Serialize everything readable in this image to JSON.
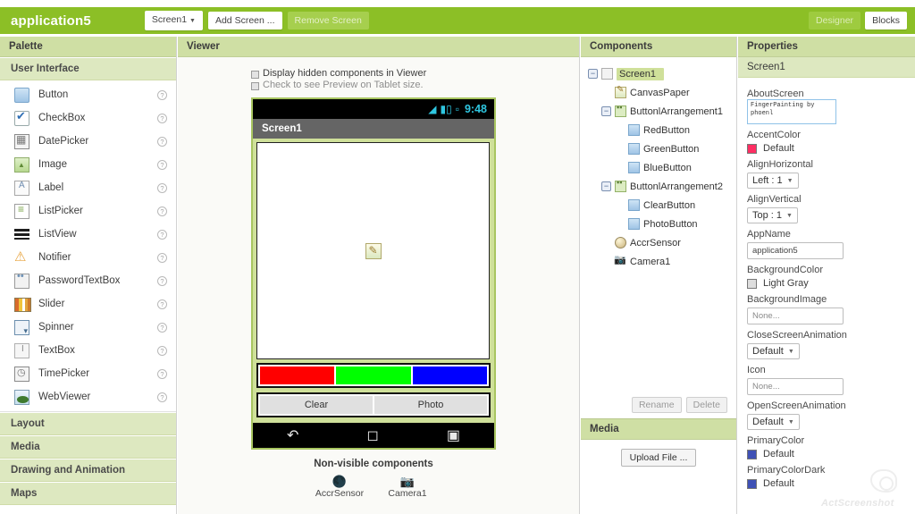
{
  "topbar": {
    "app_title": "application5",
    "screen_selector": "Screen1",
    "add_screen": "Add Screen ...",
    "remove_screen": "Remove Screen",
    "designer": "Designer",
    "blocks": "Blocks",
    "accent_green": "#8CBF26"
  },
  "panels": {
    "palette": "Palette",
    "viewer": "Viewer",
    "components": "Components",
    "properties": "Properties",
    "media": "Media"
  },
  "palette": {
    "sections": [
      "User Interface",
      "Layout",
      "Media",
      "Drawing and Animation",
      "Maps"
    ],
    "active_section": "User Interface",
    "items": [
      {
        "label": "Button",
        "icon": "button-icon",
        "help": "?"
      },
      {
        "label": "CheckBox",
        "icon": "checkbox-icon",
        "help": "?"
      },
      {
        "label": "DatePicker",
        "icon": "datepicker-icon",
        "help": "?"
      },
      {
        "label": "Image",
        "icon": "image-icon",
        "help": "?"
      },
      {
        "label": "Label",
        "icon": "label-icon",
        "help": "?"
      },
      {
        "label": "ListPicker",
        "icon": "listpicker-icon",
        "help": "?"
      },
      {
        "label": "ListView",
        "icon": "listview-icon",
        "help": "?"
      },
      {
        "label": "Notifier",
        "icon": "notifier-icon",
        "help": "?"
      },
      {
        "label": "PasswordTextBox",
        "icon": "passwordtextbox-icon",
        "help": "?"
      },
      {
        "label": "Slider",
        "icon": "slider-icon",
        "help": "?"
      },
      {
        "label": "Spinner",
        "icon": "spinner-icon",
        "help": "?"
      },
      {
        "label": "TextBox",
        "icon": "textbox-icon",
        "help": "?"
      },
      {
        "label": "TimePicker",
        "icon": "timepicker-icon",
        "help": "?"
      },
      {
        "label": "WebViewer",
        "icon": "webviewer-icon",
        "help": "?"
      }
    ]
  },
  "viewer": {
    "checkbox_hidden": "Display hidden components in Viewer",
    "checkbox_tablet": "Check to see Preview on Tablet size.",
    "phone": {
      "status_time": "9:48",
      "title": "Screen1",
      "color_buttons": [
        {
          "name": "RedButton",
          "color": "#FF0000"
        },
        {
          "name": "GreenButton",
          "color": "#00FF00"
        },
        {
          "name": "BlueButton",
          "color": "#0000FF"
        }
      ],
      "action_buttons": [
        "Clear",
        "Photo"
      ],
      "nav_icons": [
        "back-icon",
        "home-icon",
        "recents-icon"
      ]
    },
    "non_visible_title": "Non-visible components",
    "non_visible": [
      {
        "label": "AccrSensor",
        "icon": "sensor-icon"
      },
      {
        "label": "Camera1",
        "icon": "camera-icon"
      }
    ]
  },
  "components": {
    "tree": [
      {
        "label": "Screen1",
        "depth": 0,
        "toggle": "−",
        "icon": "screen-icon",
        "selected": true
      },
      {
        "label": "CanvasPaper",
        "depth": 1,
        "toggle": "",
        "icon": "canvas-icon",
        "selected": false
      },
      {
        "label": "ButtonlArrangement1",
        "depth": 0,
        "toggle": "−",
        "icon": "arrangement-icon",
        "selected": false
      },
      {
        "label": "RedButton",
        "depth": 2,
        "toggle": "",
        "icon": "button-icon",
        "selected": false
      },
      {
        "label": "GreenButton",
        "depth": 2,
        "toggle": "",
        "icon": "button-icon",
        "selected": false
      },
      {
        "label": "BlueButton",
        "depth": 2,
        "toggle": "",
        "icon": "button-icon",
        "selected": false
      },
      {
        "label": "ButtonlArrangement2",
        "depth": 0,
        "toggle": "−",
        "icon": "arrangement-icon",
        "selected": false
      },
      {
        "label": "ClearButton",
        "depth": 2,
        "toggle": "",
        "icon": "button-icon",
        "selected": false
      },
      {
        "label": "PhotoButton",
        "depth": 2,
        "toggle": "",
        "icon": "button-icon",
        "selected": false
      },
      {
        "label": "AccrSensor",
        "depth": 1,
        "toggle": "",
        "icon": "sensor-icon",
        "selected": false
      },
      {
        "label": "Camera1",
        "depth": 1,
        "toggle": "",
        "icon": "camera-icon",
        "selected": false
      }
    ],
    "rename": "Rename",
    "delete": "Delete"
  },
  "media": {
    "upload": "Upload File ..."
  },
  "properties": {
    "selected_component": "Screen1",
    "items": [
      {
        "name": "AboutScreen",
        "type": "textarea",
        "value": "FingerPainting by\nphoenl"
      },
      {
        "name": "AccentColor",
        "type": "color",
        "value": "Default",
        "swatch": "#FF2E63"
      },
      {
        "name": "AlignHorizontal",
        "type": "select",
        "value": "Left : 1"
      },
      {
        "name": "AlignVertical",
        "type": "select",
        "value": "Top : 1"
      },
      {
        "name": "AppName",
        "type": "input",
        "value": "application5"
      },
      {
        "name": "BackgroundColor",
        "type": "color",
        "value": "Light Gray",
        "swatch": "#DDDDDD"
      },
      {
        "name": "BackgroundImage",
        "type": "input",
        "value": "None...",
        "muted": true
      },
      {
        "name": "CloseScreenAnimation",
        "type": "select",
        "value": "Default"
      },
      {
        "name": "Icon",
        "type": "input",
        "value": "None...",
        "muted": true
      },
      {
        "name": "OpenScreenAnimation",
        "type": "select",
        "value": "Default"
      },
      {
        "name": "PrimaryColor",
        "type": "color",
        "value": "Default",
        "swatch": "#3F51B5"
      },
      {
        "name": "PrimaryColorDark",
        "type": "color",
        "value": "Default",
        "swatch": "#3F51B5"
      }
    ]
  },
  "watermark": {
    "text": "ActScreenshot"
  }
}
